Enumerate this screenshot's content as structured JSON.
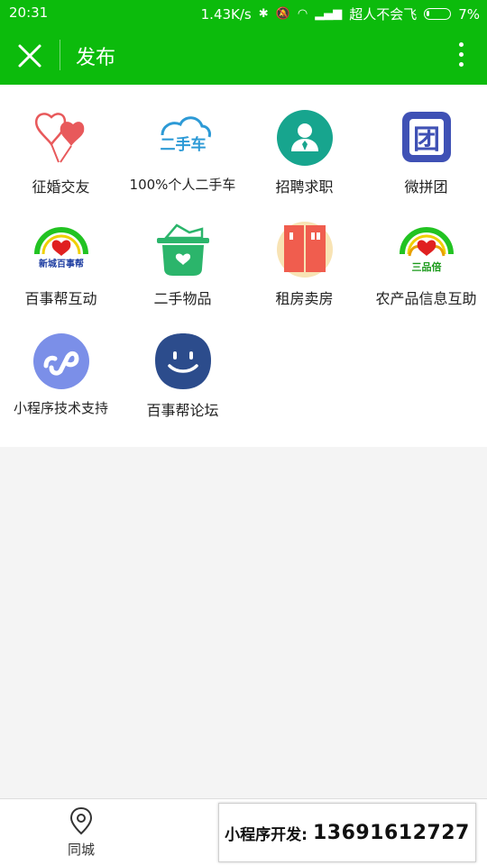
{
  "status_bar": {
    "time": "20:31",
    "speed": "1.43K/s",
    "carrier": "超人不会飞",
    "battery": "7%"
  },
  "header": {
    "title": "发布",
    "accent_color": "#0cbb0c"
  },
  "grid": [
    {
      "label": "征婚交友",
      "icon": "heart-balloons-icon"
    },
    {
      "label": "100%个人二手车",
      "icon": "used-car-icon",
      "icon_text": "二手车"
    },
    {
      "label": "招聘求职",
      "icon": "recruit-person-icon"
    },
    {
      "label": "微拼团",
      "icon": "group-buy-icon",
      "icon_text": "团"
    },
    {
      "label": "百事帮互动",
      "icon": "baishibang-logo-icon",
      "icon_text": "新城百事帮"
    },
    {
      "label": "二手物品",
      "icon": "secondhand-basket-icon"
    },
    {
      "label": "租房卖房",
      "icon": "building-icon"
    },
    {
      "label": "农产品信息互助",
      "icon": "agri-logo-icon",
      "icon_text": "三品倍"
    },
    {
      "label": "小程序技术支持",
      "icon": "mini-program-icon"
    },
    {
      "label": "百事帮论坛",
      "icon": "smile-forum-icon"
    }
  ],
  "bottom_bar": {
    "tab_label": "同城",
    "promo_text": "小程序开发:",
    "promo_phone": "13691612727"
  }
}
